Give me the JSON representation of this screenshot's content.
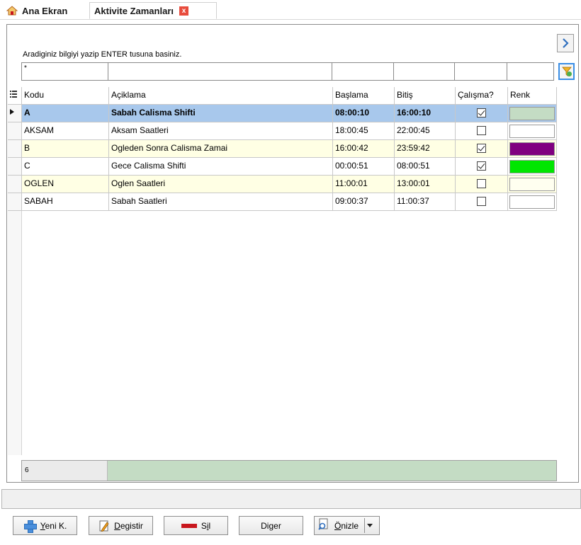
{
  "tabs": {
    "home_label": "Ana Ekran",
    "active_label": "Aktivite Zamanları",
    "close_glyph": "x"
  },
  "search": {
    "hint": "Aradiginiz bilgiyi yazip ENTER tusuna basiniz.",
    "filter_value": "*"
  },
  "grid": {
    "columns": [
      "Kodu",
      "Açiklama",
      "Başlama",
      "Bitiş",
      "Çalışma?",
      "Renk"
    ],
    "rows": [
      {
        "kodu": "A",
        "aciklama": "Sabah Calisma Shifti",
        "baslama": "08:00:10",
        "bitis": "16:00:10",
        "calisma": true,
        "renk": "#c4dcc4"
      },
      {
        "kodu": "AKSAM",
        "aciklama": "Aksam Saatleri",
        "baslama": "18:00:45",
        "bitis": "22:00:45",
        "calisma": false,
        "renk": "#ffffff"
      },
      {
        "kodu": "B",
        "aciklama": "Ogleden Sonra Calisma Zamai",
        "baslama": "16:00:42",
        "bitis": "23:59:42",
        "calisma": true,
        "renk": "#800080"
      },
      {
        "kodu": "C",
        "aciklama": "Gece Calisma Shifti",
        "baslama": "00:00:51",
        "bitis": "08:00:51",
        "calisma": true,
        "renk": "#00e600"
      },
      {
        "kodu": "OGLEN",
        "aciklama": "Oglen Saatleri",
        "baslama": "11:00:01",
        "bitis": "13:00:01",
        "calisma": false,
        "renk": "#fffff0"
      },
      {
        "kodu": "SABAH",
        "aciklama": "Sabah Saatleri",
        "baslama": "09:00:37",
        "bitis": "11:00:37",
        "calisma": false,
        "renk": "#ffffff"
      }
    ],
    "record_count": "6"
  },
  "buttons": {
    "new": {
      "key": "Y",
      "rest": "eni K."
    },
    "edit": {
      "key": "D",
      "rest": "egistir"
    },
    "delete": {
      "pre": "S",
      "key": "i",
      "rest": "l"
    },
    "other": {
      "pre": "Di",
      "key": "g",
      "rest": "er"
    },
    "preview": {
      "key": "Ö",
      "rest": "nizle"
    }
  },
  "colors": {
    "selected_row": "#a8c8ec",
    "alt_row": "#ffffe4",
    "footer_bar": "#c4dcc4",
    "accent_blue": "#3a8ee6"
  }
}
